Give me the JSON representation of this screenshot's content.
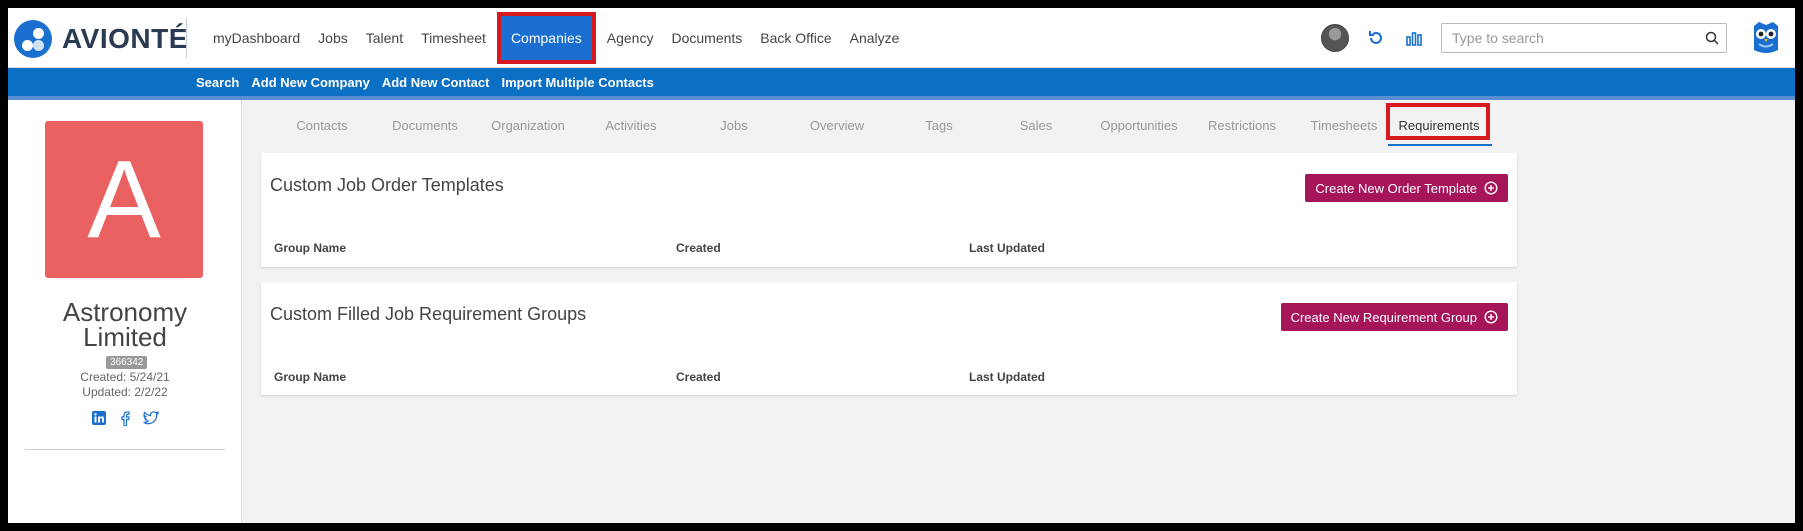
{
  "brand": {
    "name": "AVIONTÉ"
  },
  "nav": {
    "items": [
      "myDashboard",
      "Jobs",
      "Talent",
      "Timesheet",
      "Companies",
      "Agency",
      "Documents",
      "Back Office",
      "Analyze"
    ],
    "active": "Companies"
  },
  "search": {
    "placeholder": "Type to search"
  },
  "subnav": {
    "items": [
      "Search",
      "Add New Company",
      "Add New Contact",
      "Import Multiple Contacts"
    ]
  },
  "company": {
    "avatar_letter": "A",
    "name_line1": "Astronomy",
    "name_line2": "Limited",
    "id": "366342",
    "created": "Created: 5/24/21",
    "updated": "Updated: 2/2/22",
    "avatar_color": "#ea6161"
  },
  "tabs": {
    "items": [
      "Contacts",
      "Documents",
      "Organization",
      "Activities",
      "Jobs",
      "Overview",
      "Tags",
      "Sales",
      "Opportunities",
      "Restrictions",
      "Timesheets",
      "Requirements"
    ],
    "active": "Requirements"
  },
  "sections": [
    {
      "title": "Custom Job Order Templates",
      "button": "Create New Order Template",
      "columns": [
        "Group Name",
        "Created",
        "Last Updated"
      ]
    },
    {
      "title": "Custom Filled Job Requirement Groups",
      "button": "Create New Requirement Group",
      "columns": [
        "Group Name",
        "Created",
        "Last Updated"
      ]
    }
  ],
  "colors": {
    "primary": "#1a6fd1",
    "subnav": "#0b6fc4",
    "button": "#a6145a",
    "highlight": "#d71920"
  },
  "icons": [
    "refresh-icon",
    "analytics-icon",
    "search-icon",
    "owl-icon",
    "linkedin-icon",
    "facebook-icon",
    "twitter-icon",
    "plus-circle-icon"
  ]
}
